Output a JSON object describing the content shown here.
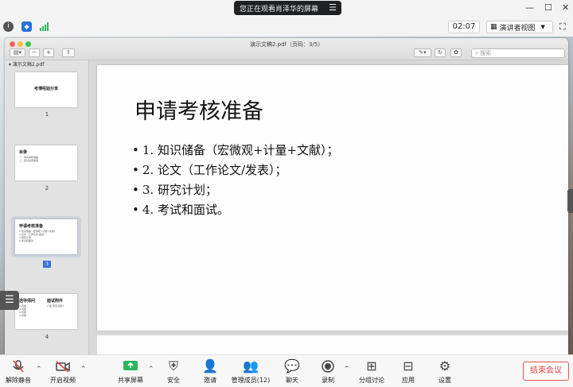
{
  "banner": {
    "text": "您正在观看肖泽华的屏幕",
    "menu_icon": "menu-icon"
  },
  "window_controls": [
    "—",
    "☐",
    "✕"
  ],
  "status": {
    "timer": "02:07",
    "view_button": "演讲者视图"
  },
  "pdf": {
    "title": "演示文稿2.pdf（页码：3/5）",
    "search_placeholder": "搜索",
    "sidebar_title": "演示文稿2.pdf",
    "thumbs": [
      {
        "title": "考博经验分享",
        "num": "1",
        "lines": []
      },
      {
        "title": "目录",
        "num": "2",
        "lines": [
          "一、申请考核准备",
          "二、复试注意事项"
        ]
      },
      {
        "title": "申请考核准备",
        "num": "3",
        "lines": [
          "1.知识储备（宏微观+计量+文献）",
          "2.论文（工作论文/发表）",
          "3.研究计划",
          "4.考试和面试"
        ]
      },
      {
        "title": "选导师问",
        "num": "4",
        "lines": [
          "1.问题",
          "2.问题",
          "3.问题",
          "4.问题"
        ]
      }
    ],
    "thumb4_right_title": "面试附件",
    "thumb4_right_line": "介绍 研究问题 1",
    "slide": {
      "title": "申请考核准备",
      "bullets": [
        "1. 知识储备（宏微观+计量+文献）；",
        "2. 论文（工作论文/发表）；",
        "3. 研究计划；",
        "4. 考试和面试。"
      ]
    }
  },
  "toolbar": {
    "mute": "解除静音",
    "video": "开启视频",
    "share": "共享屏幕",
    "security": "安全",
    "invite": "邀请",
    "participants": "管理成员(12)",
    "chat": "聊天",
    "record": "录制",
    "breakout": "分组讨论",
    "apps": "应用",
    "settings": "设置",
    "end": "结束会议"
  },
  "colors": {
    "end_red": "#e04040",
    "accent_green": "#2db55d",
    "select_blue": "#3a6fd8"
  }
}
